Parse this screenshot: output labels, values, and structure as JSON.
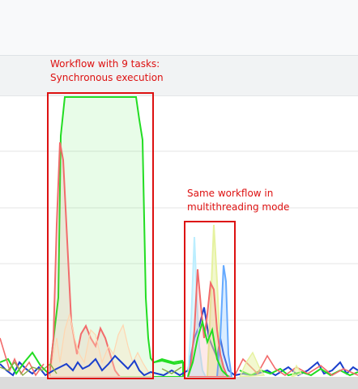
{
  "annotations": {
    "sync": {
      "line1": "Workflow with 9 tasks:",
      "line2": "Synchronous execution"
    },
    "multi": {
      "line1": "Same workflow in",
      "line2": "multithreading mode"
    }
  },
  "colors": {
    "annotation": "#dd1111",
    "sync_series": "#22dd22",
    "grid": "#e6e6e6"
  },
  "chart_data": {
    "type": "area",
    "grid": true,
    "series_colors": [
      "#22dd22",
      "#f26b6b",
      "#1a3fcc",
      "#ffb0a0",
      "#99ccff",
      "#e6f2a0",
      "#66bb66",
      "#ffe0c0",
      "#bbeeff"
    ]
  }
}
